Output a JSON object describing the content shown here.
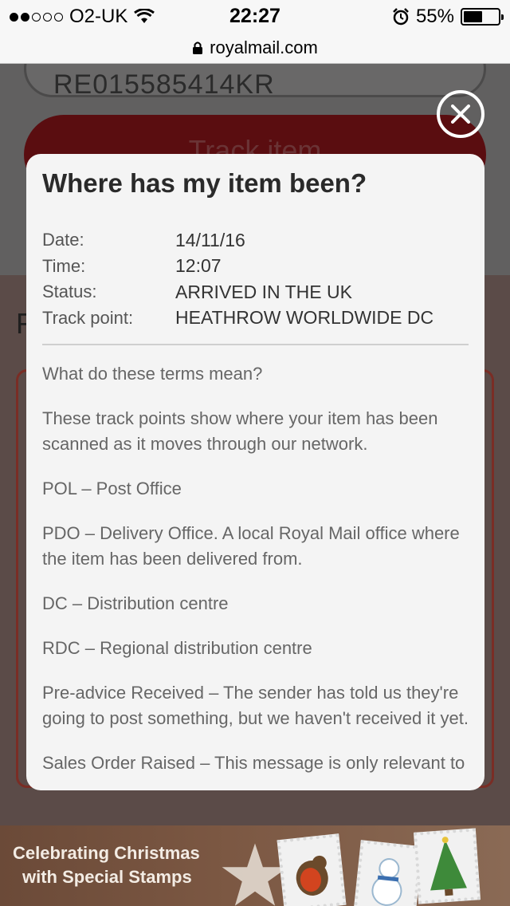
{
  "status_bar": {
    "carrier": "O2-UK",
    "time": "22:27",
    "battery": "55%",
    "battery_level": 0.55
  },
  "url_bar": {
    "domain": "royalmail.com"
  },
  "background_page": {
    "tracking_number": "RE015585414KR",
    "track_button": "Track item",
    "section_letter": "F"
  },
  "modal": {
    "title": "Where has my item been?",
    "details": [
      {
        "label": "Date:",
        "value": "14/11/16"
      },
      {
        "label": "Time:",
        "value": "12:07"
      },
      {
        "label": "Status:",
        "value": "ARRIVED IN THE UK"
      },
      {
        "label": "Track point:",
        "value": "HEATHROW WORLDWIDE DC"
      }
    ],
    "terms": [
      "What do these terms mean?",
      "These track points show where your item has been scanned as it moves through our network.",
      "POL – Post Office",
      "PDO – Delivery Office. A local Royal Mail office where the item has been delivered from.",
      "DC – Distribution centre",
      "RDC – Regional distribution centre",
      "Pre-advice Received – The sender has told us they're going to post something, but we haven't received it yet.",
      "Sales Order Raised – This message is only relevant to"
    ]
  },
  "banner": {
    "line1": "Celebrating Christmas",
    "line2": "with Special Stamps"
  }
}
